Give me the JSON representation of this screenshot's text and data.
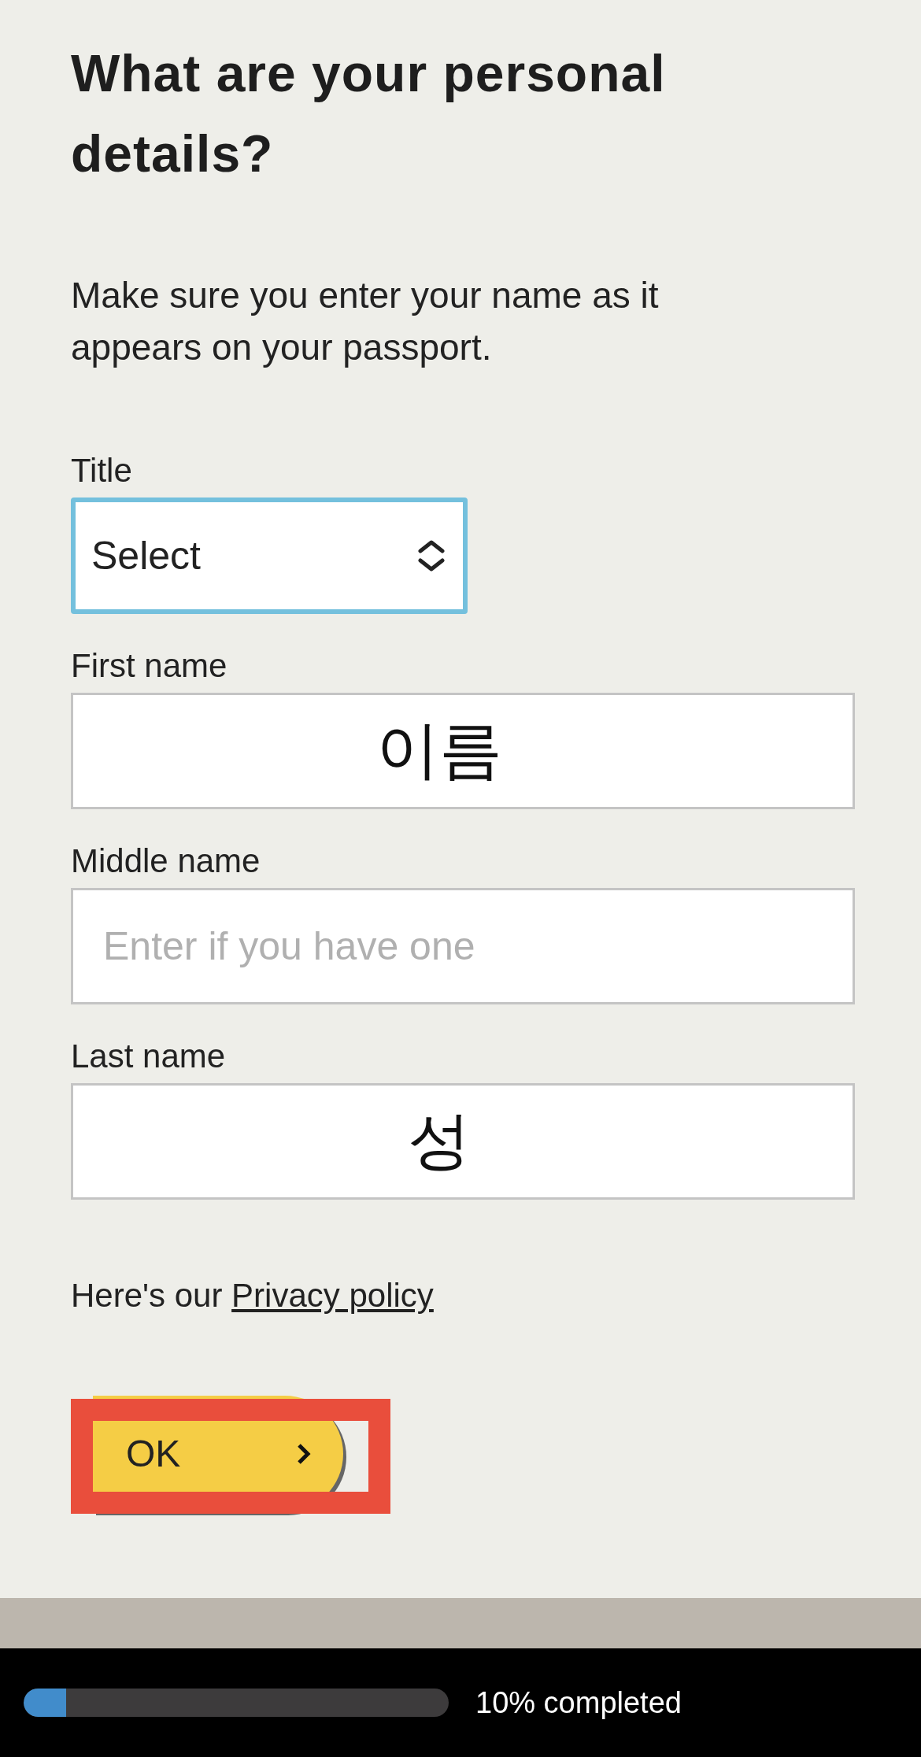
{
  "heading": "What are your personal details?",
  "intro": "Make sure you enter your name as it appears on your passport.",
  "fields": [
    {
      "kind": "select",
      "label": "Title",
      "value": "Select",
      "focused": true
    },
    {
      "kind": "text",
      "label": "First name",
      "value": "이름",
      "focused": false
    },
    {
      "kind": "text",
      "label": "Middle name",
      "placeholder": "Enter if you have one",
      "focused": false
    },
    {
      "kind": "text",
      "label": "Last name",
      "value": "성",
      "focused": false
    }
  ],
  "privacy": {
    "text": "Here's our",
    "link": "Privacy policy"
  },
  "ok_button": {
    "label": "OK",
    "highlighted": true
  },
  "progress": {
    "level": 0.1,
    "label": "10% completed"
  }
}
